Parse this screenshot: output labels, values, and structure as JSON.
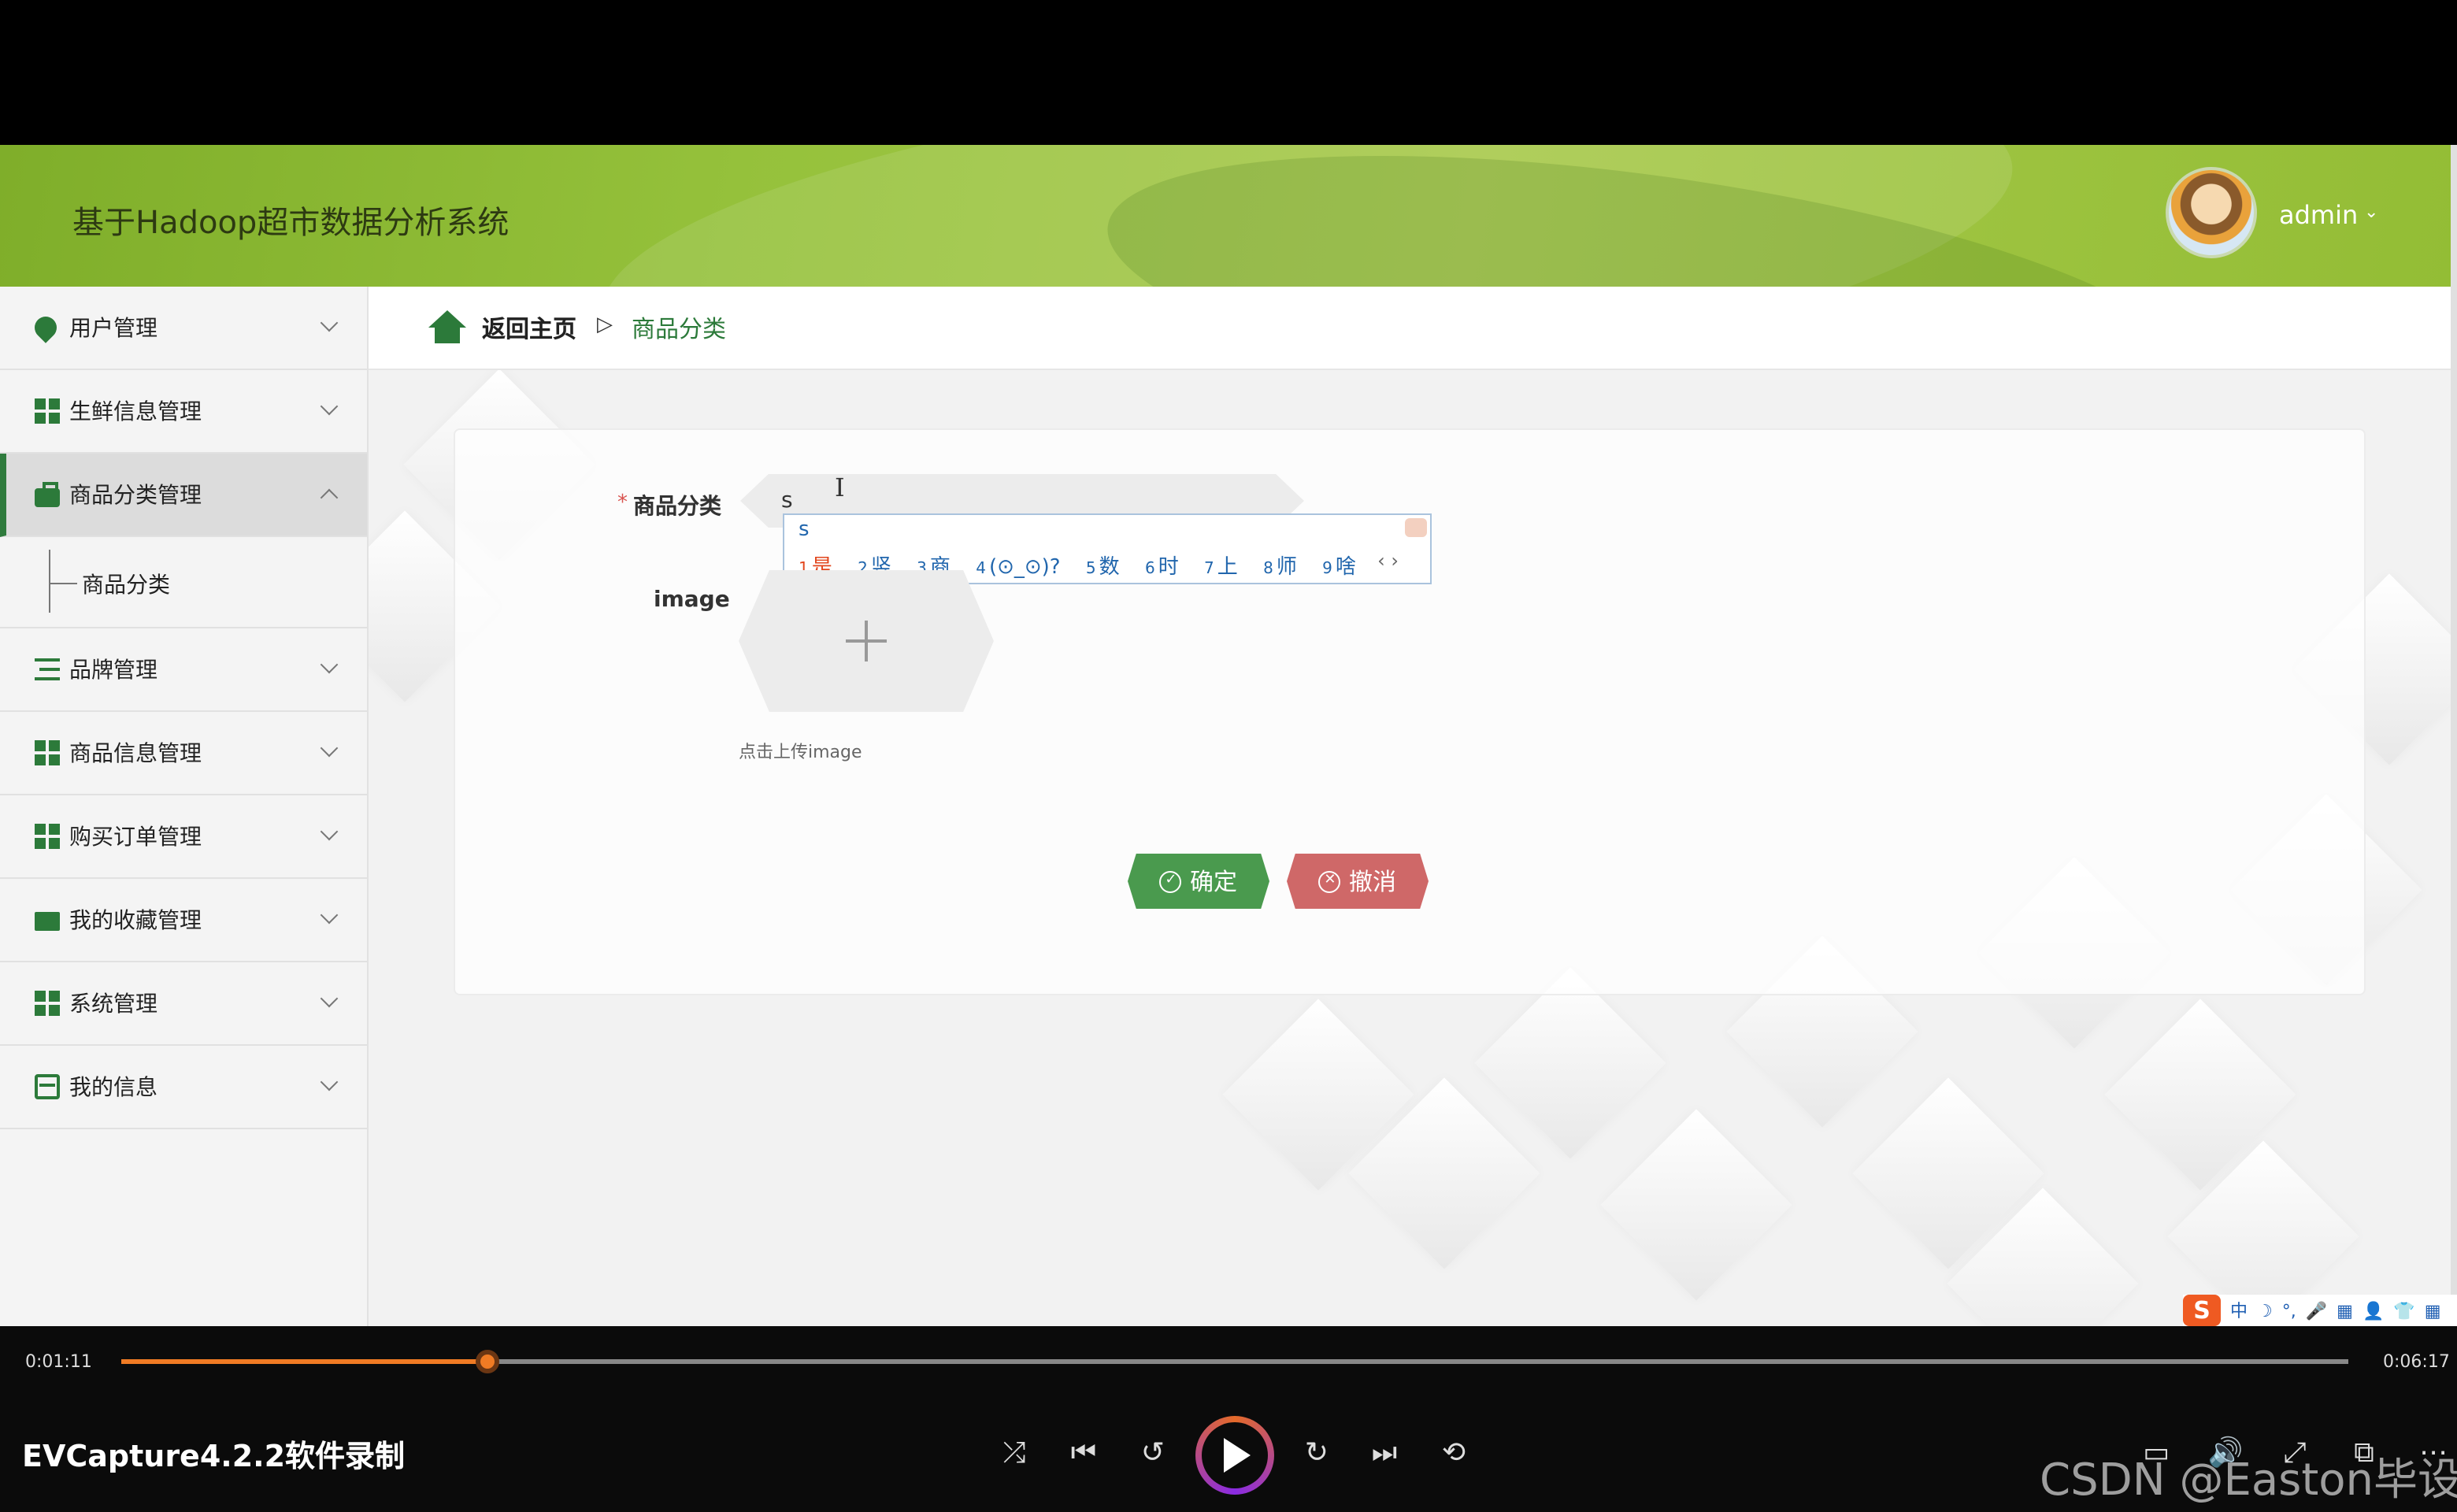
{
  "header": {
    "title": "基于Hadoop超市数据分析系统",
    "user": "admin",
    "caret": "⌄"
  },
  "sidebar": {
    "items": [
      {
        "label": "用户管理",
        "icon": "bulb-icon"
      },
      {
        "label": "生鲜信息管理",
        "icon": "grid-icon"
      },
      {
        "label": "商品分类管理",
        "icon": "briefcase-icon",
        "expanded": true
      },
      {
        "label": "品牌管理",
        "icon": "list-icon"
      },
      {
        "label": "商品信息管理",
        "icon": "grid-icon"
      },
      {
        "label": "购买订单管理",
        "icon": "grid-icon"
      },
      {
        "label": "我的收藏管理",
        "icon": "ticket-icon"
      },
      {
        "label": "系统管理",
        "icon": "grid-icon"
      },
      {
        "label": "我的信息",
        "icon": "card-icon"
      }
    ],
    "sub_item": "商品分类"
  },
  "breadcrumb": {
    "home": "返回主页",
    "separator": "▷",
    "current": "商品分类"
  },
  "form": {
    "required_mark": "*",
    "category_label": "商品分类",
    "category_value": "s",
    "image_label": "image",
    "upload_hint": "点击上传image",
    "ok_label": "确定",
    "cancel_label": "撤消"
  },
  "ime": {
    "composition": "s",
    "candidates": [
      {
        "n": "1",
        "text": "是"
      },
      {
        "n": "2",
        "text": "竖"
      },
      {
        "n": "3",
        "text": "商"
      },
      {
        "n": "4",
        "text": "(⊙_⊙)?"
      },
      {
        "n": "5",
        "text": "数"
      },
      {
        "n": "6",
        "text": "时"
      },
      {
        "n": "7",
        "text": "上"
      },
      {
        "n": "8",
        "text": "师"
      },
      {
        "n": "9",
        "text": "啥"
      }
    ],
    "nav": "‹ ›",
    "tray": {
      "logo": "S",
      "mode": "中",
      "moon": "☽",
      "punct": "°,",
      "mic": "🎤",
      "keyboard": "▦",
      "user": "👤",
      "shirt": "👕",
      "apps": "▦"
    }
  },
  "player": {
    "current_time": "0:01:11",
    "total_time": "0:06:17",
    "progress": 0.165,
    "recorder_label": "EVCapture4.2.2软件录制",
    "controls": {
      "shuffle": "⤮",
      "prev": "⏮",
      "back10": "↺",
      "fwd30": "↻",
      "next": "⏭",
      "loop": "⟲"
    },
    "right_icons": {
      "subtitle": "▭",
      "volume": "🔊",
      "expand": "⤢",
      "pip": "⧉",
      "more": "⋯"
    },
    "watermark": "CSDN @Easton毕设"
  },
  "colors": {
    "accent": "#2c7a3a",
    "ok": "#4a9a4e",
    "cancel": "#cf6868",
    "progress": "#f07b24"
  }
}
